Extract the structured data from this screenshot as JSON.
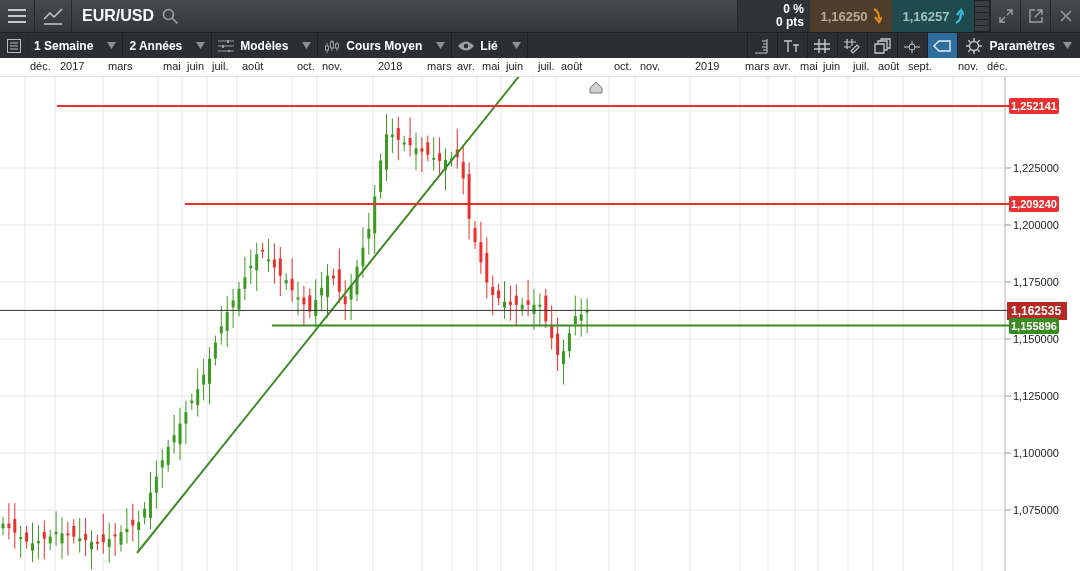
{
  "header": {
    "symbol": "EUR/USD",
    "change_percent": "0 %",
    "change_points": "0 pts",
    "sell_price": "1,16250",
    "buy_price": "1,16257"
  },
  "toolbar": {
    "dropdowns": [
      {
        "kind": "plain",
        "label": "1 Semaine"
      },
      {
        "kind": "plain",
        "label": "2 Années"
      },
      {
        "kind": "models",
        "label": "Modèles"
      },
      {
        "kind": "candles",
        "label": "Cours Moyen"
      },
      {
        "kind": "link",
        "label": "Lié"
      }
    ],
    "tools": [
      {
        "kind": "ruler",
        "selected": false
      },
      {
        "kind": "text",
        "selected": false
      },
      {
        "kind": "grid",
        "selected": false
      },
      {
        "kind": "grid-pen",
        "selected": false
      },
      {
        "kind": "layers",
        "selected": false
      },
      {
        "kind": "crosshair",
        "selected": false
      },
      {
        "kind": "tag",
        "selected": true
      }
    ],
    "settings": "Paramètres"
  },
  "time_axis": [
    "déc.",
    "2017",
    "mars",
    "mai",
    "juin",
    "juil.",
    "août",
    "oct.",
    "nov.",
    "2018",
    "mars",
    "avr.",
    "mai",
    "juin",
    "juil.",
    "août",
    "oct.",
    "nov.",
    "2019",
    "mars",
    "avr.",
    "mai",
    "juin",
    "juil.",
    "août",
    "sept.",
    "nov.",
    "déc."
  ],
  "price_axis": [
    "1,225000",
    "1,200000",
    "1,175000",
    "1,150000",
    "1,125000",
    "1,100000",
    "1,075000"
  ],
  "levels": [
    {
      "kind": "resistance",
      "label": "1,252141",
      "color": "#e8312f"
    },
    {
      "kind": "resistance",
      "label": "1,209240",
      "color": "#e8312f"
    },
    {
      "kind": "current",
      "label": "1,162535",
      "color": "#b52a24"
    },
    {
      "kind": "support",
      "label": "1,155896",
      "color": "#3c8a22"
    }
  ]
}
